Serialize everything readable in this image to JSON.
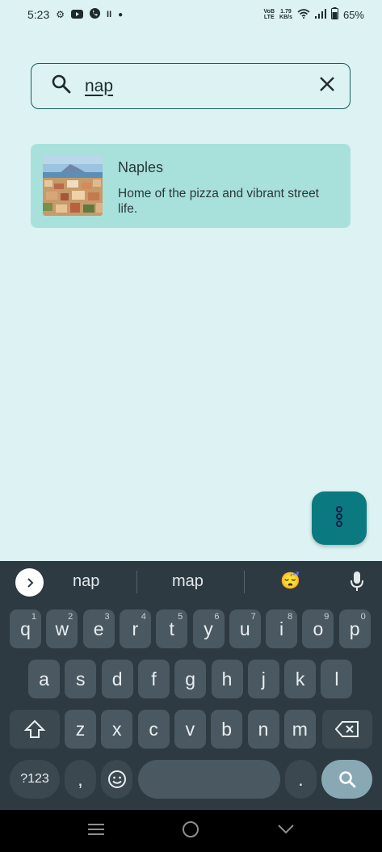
{
  "status_bar": {
    "time": "5:23",
    "network_label_top": "VoB",
    "network_label_bottom": "LTE",
    "speed_value": "1.79",
    "speed_unit": "KB/s",
    "battery": "65%"
  },
  "search": {
    "query": "nap",
    "icon": "search-icon",
    "clear_icon": "close-icon"
  },
  "results": [
    {
      "title": "Naples",
      "description": "Home of the pizza and vibrant street life."
    }
  ],
  "fab": {
    "icon": "more-vert-icon"
  },
  "keyboard": {
    "suggestions": [
      "nap",
      "map",
      "😴"
    ],
    "row1": [
      {
        "k": "q",
        "n": "1"
      },
      {
        "k": "w",
        "n": "2"
      },
      {
        "k": "e",
        "n": "3"
      },
      {
        "k": "r",
        "n": "4"
      },
      {
        "k": "t",
        "n": "5"
      },
      {
        "k": "y",
        "n": "6"
      },
      {
        "k": "u",
        "n": "7"
      },
      {
        "k": "i",
        "n": "8"
      },
      {
        "k": "o",
        "n": "9"
      },
      {
        "k": "p",
        "n": "0"
      }
    ],
    "row2": [
      "a",
      "s",
      "d",
      "f",
      "g",
      "h",
      "j",
      "k",
      "l"
    ],
    "row3": [
      "z",
      "x",
      "c",
      "v",
      "b",
      "n",
      "m"
    ],
    "symbols_label": "?123",
    "comma": ",",
    "period": "."
  },
  "colors": {
    "background": "#dcf2f3",
    "card": "#a8e1dc",
    "accent": "#0b7a80",
    "keyboard": "#2e3a42"
  }
}
